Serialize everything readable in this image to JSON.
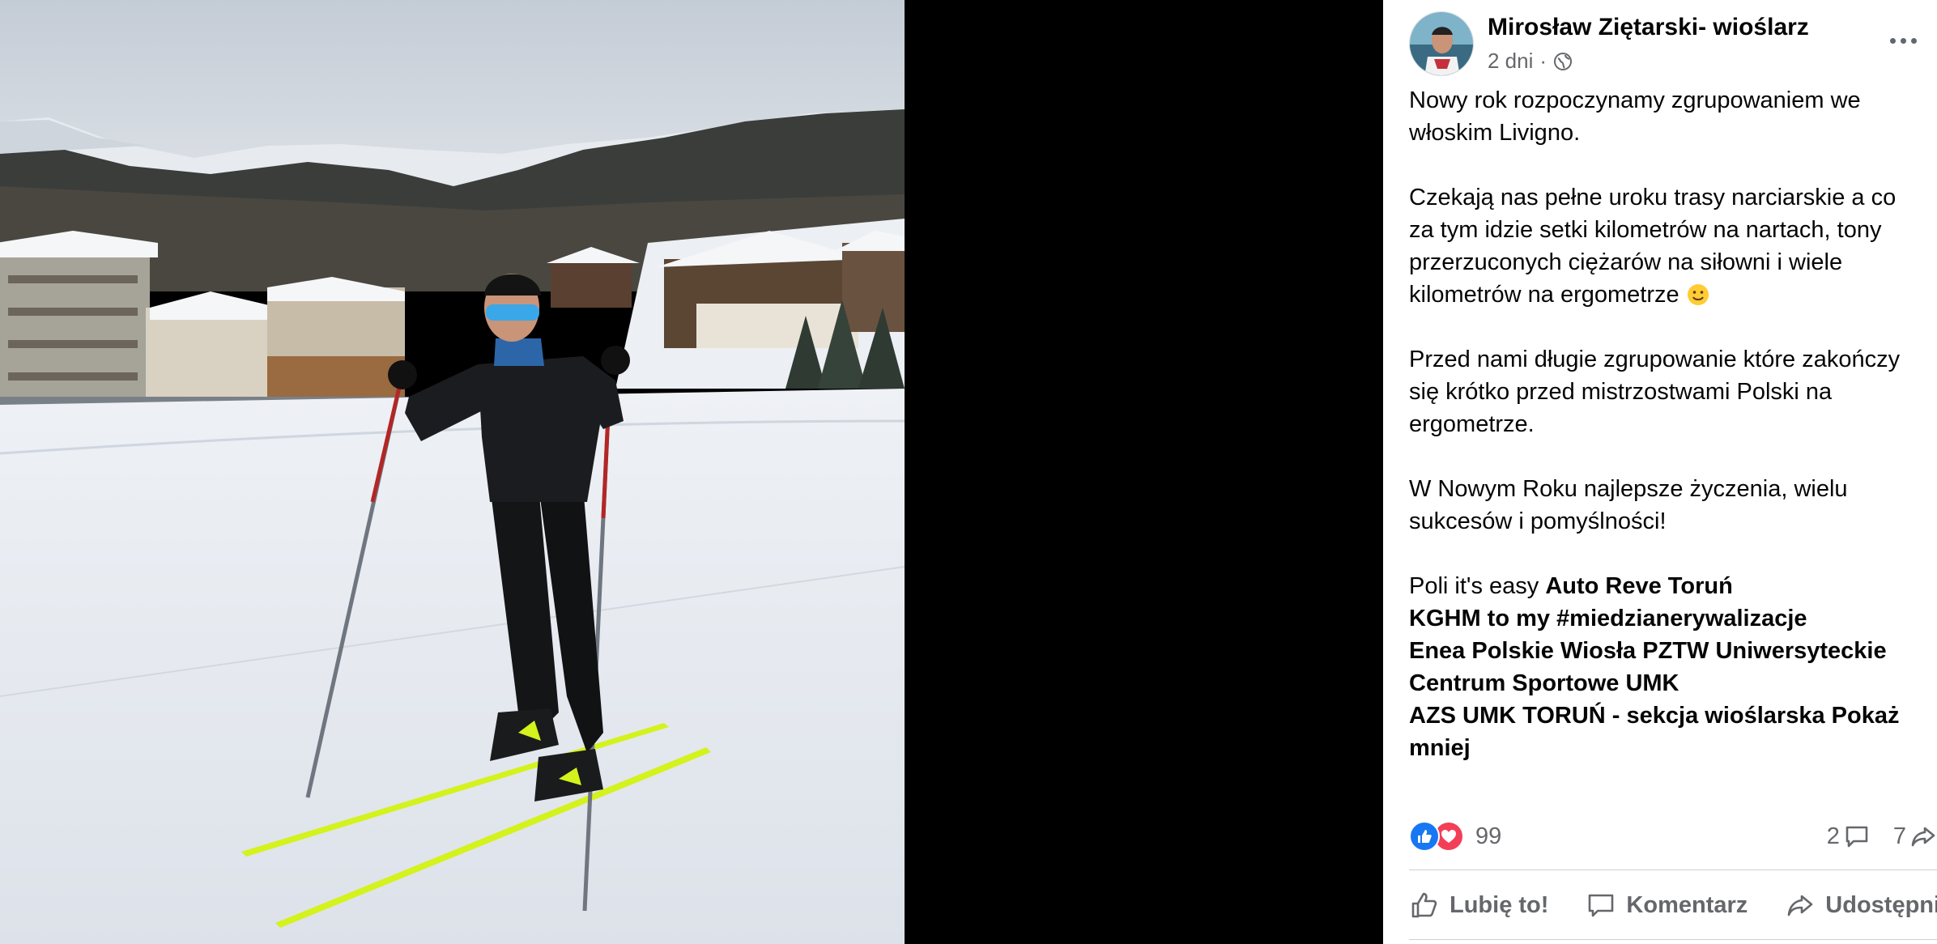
{
  "post": {
    "author": "Mirosław Ziętarski- wioślarz",
    "time": "2 dni",
    "dot": "·",
    "privacy_icon": "globe-icon",
    "paragraphs": {
      "p1_line1": "Nowy rok rozpoczynamy zgrupowaniem we",
      "p1_line2": "włoskim Livigno.",
      "p2_line1": "Czekają nas pełne uroku trasy narciarskie a co",
      "p2_line2": "za tym idzie setki kilometrów na nartach, tony",
      "p2_line3": "przerzuconych ciężarów na siłowni i wiele",
      "p2_line4": "kilometrów na ergometrze",
      "p3_line1": "Przed nami długie zgrupowanie które zakończy",
      "p3_line2": "się krótko przed mistrzostwami Polski na",
      "p3_line3": "ergometrze.",
      "p4_line1": "W Nowym Roku najlepsze życzenia, wielu",
      "p4_line2": "sukcesów i pomyślności!"
    },
    "sponsors": {
      "prefix": "Poli it's easy ",
      "auto_reve": "Auto Reve Toruń",
      "kghm": "KGHM to my #miedzianerywalizacje",
      "enea_line1": "Enea Polskie Wiosła PZTW Uniwersyteckie",
      "enea_line2": "Centrum Sportowe UMK",
      "azs": "AZS UMK TORUŃ - sekcja wioślarska",
      "show_less": "Pokaż",
      "show_less_2": "mniej"
    }
  },
  "stats": {
    "reactions_count": "99",
    "comments_count": "2",
    "shares_count": "7"
  },
  "actions": {
    "like": "Lubię to!",
    "comment": "Komentarz",
    "share": "Udostępnij"
  },
  "colors": {
    "like_blue": "#1877f2",
    "love_red": "#f33e58",
    "ski_yellow": "#d4f21c"
  }
}
